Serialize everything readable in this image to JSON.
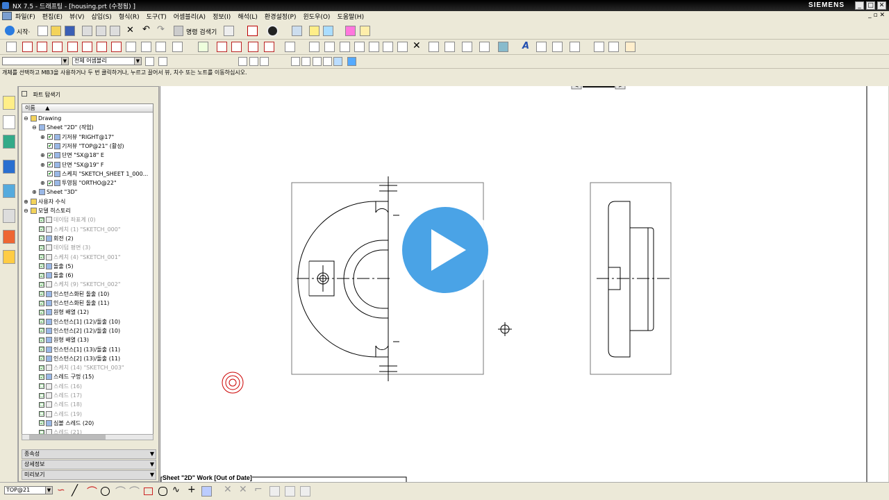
{
  "window": {
    "title": "NX 7.5 - 드래프팅 - [housing.prt (수정됨) ]",
    "brand": "SIEMENS"
  },
  "menu": [
    "파일(F)",
    "편집(E)",
    "뷰(V)",
    "삽입(S)",
    "형식(R)",
    "도구(T)",
    "어셈블리(A)",
    "정보(I)",
    "해석(L)",
    "환경설정(P)",
    "윈도우(O)",
    "도움말(H)"
  ],
  "toolbar1": {
    "start_label": "시작·",
    "command_finder_label": "명령 검색기"
  },
  "filter_bar": {
    "type_filter": "",
    "scope_filter": "전체 어셈블리"
  },
  "hint_text": "개체를 선택하고 MB3을 사용하거나 두 번 클릭하거나, 누르고 끌어서 뷰, 치수 또는 노트를 이동하십시오.",
  "navigator": {
    "title": "파트 탐색기",
    "column_header": "이름",
    "rows": [
      {
        "label": "Drawing",
        "indent": 0,
        "expander": "⊖",
        "check": "",
        "dim": false
      },
      {
        "label": "Sheet \"2D\" (작업)",
        "indent": 1,
        "expander": "⊖",
        "check": "",
        "dim": false
      },
      {
        "label": "기저뷰 \"RIGHT@17\"",
        "indent": 2,
        "expander": "⊕",
        "check": "✔",
        "dim": false
      },
      {
        "label": "기저뷰 \"TOP@21\" (활성)",
        "indent": 2,
        "expander": "",
        "check": "✔",
        "dim": false
      },
      {
        "label": "단면 \"SX@18\" E",
        "indent": 2,
        "expander": "⊕",
        "check": "✔",
        "dim": false
      },
      {
        "label": "단면 \"SX@19\" F",
        "indent": 2,
        "expander": "⊕",
        "check": "✔",
        "dim": false
      },
      {
        "label": "스케치 \"SKETCH_SHEET 1_000...",
        "indent": 2,
        "expander": "",
        "check": "✔",
        "dim": false
      },
      {
        "label": "투영됨 \"ORTHO@22\"",
        "indent": 2,
        "expander": "⊕",
        "check": "✔",
        "dim": false
      },
      {
        "label": "Sheet \"3D\"",
        "indent": 1,
        "expander": "⊕",
        "check": "",
        "dim": false
      },
      {
        "label": "사용자 수식",
        "indent": 0,
        "expander": "⊕",
        "check": "",
        "dim": false
      },
      {
        "label": "모델 히스토리",
        "indent": 0,
        "expander": "⊖",
        "check": "",
        "dim": false
      },
      {
        "label": "데이텀 좌표계 (0)",
        "indent": 1,
        "expander": "",
        "check": "☑",
        "dim": true
      },
      {
        "label": "스케치 (1) \"SKETCH_000\"",
        "indent": 1,
        "expander": "",
        "check": "☑",
        "dim": true
      },
      {
        "label": "회전 (2)",
        "indent": 1,
        "expander": "",
        "check": "☑",
        "dim": false
      },
      {
        "label": "데이텀 평면 (3)",
        "indent": 1,
        "expander": "",
        "check": "☑",
        "dim": true
      },
      {
        "label": "스케치 (4) \"SKETCH_001\"",
        "indent": 1,
        "expander": "",
        "check": "☑",
        "dim": true
      },
      {
        "label": "돌출 (5)",
        "indent": 1,
        "expander": "",
        "check": "☑",
        "dim": false
      },
      {
        "label": "돌출 (6)",
        "indent": 1,
        "expander": "",
        "check": "☑",
        "dim": false
      },
      {
        "label": "스케치 (9) \"SKETCH_002\"",
        "indent": 1,
        "expander": "",
        "check": "☑",
        "dim": true
      },
      {
        "label": "인스턴스화된 돌출 (10)",
        "indent": 1,
        "expander": "",
        "check": "☑",
        "dim": false
      },
      {
        "label": "인스턴스화된 돌출 (11)",
        "indent": 1,
        "expander": "",
        "check": "☑",
        "dim": false
      },
      {
        "label": "원형 배열 (12)",
        "indent": 1,
        "expander": "",
        "check": "☑",
        "dim": false
      },
      {
        "label": "인스턴스[1] (12)/돌출 (10)",
        "indent": 1,
        "expander": "",
        "check": "☑",
        "dim": false
      },
      {
        "label": "인스턴스[2] (12)/돌출 (10)",
        "indent": 1,
        "expander": "",
        "check": "☑",
        "dim": false
      },
      {
        "label": "원형 배열 (13)",
        "indent": 1,
        "expander": "",
        "check": "☑",
        "dim": false
      },
      {
        "label": "인스턴스[1] (13)/돌출 (11)",
        "indent": 1,
        "expander": "",
        "check": "☑",
        "dim": false
      },
      {
        "label": "인스턴스[2] (13)/돌출 (11)",
        "indent": 1,
        "expander": "",
        "check": "☑",
        "dim": false
      },
      {
        "label": "스케치 (14) \"SKETCH_003\"",
        "indent": 1,
        "expander": "",
        "check": "☑",
        "dim": true
      },
      {
        "label": "스레드 구멍 (15)",
        "indent": 1,
        "expander": "",
        "check": "☑",
        "dim": false
      },
      {
        "label": "스레드 (16)",
        "indent": 1,
        "expander": "",
        "check": "☐",
        "dim": true
      },
      {
        "label": "스레드 (17)",
        "indent": 1,
        "expander": "",
        "check": "☐",
        "dim": true
      },
      {
        "label": "스레드 (18)",
        "indent": 1,
        "expander": "",
        "check": "☐",
        "dim": true
      },
      {
        "label": "스레드 (19)",
        "indent": 1,
        "expander": "",
        "check": "☐",
        "dim": true
      },
      {
        "label": "심볼 스레드 (20)",
        "indent": 1,
        "expander": "",
        "check": "☑",
        "dim": false
      },
      {
        "label": "스레드 (21)",
        "indent": 1,
        "expander": "",
        "check": "☐",
        "dim": true
      }
    ],
    "panels": [
      "종속성",
      "상세정보",
      "미리보기"
    ]
  },
  "canvas": {
    "sheet_status": "Sheet \"2D\" Work [Out of Date]"
  },
  "bottom": {
    "view_combo": "TOP@21"
  },
  "colors": {
    "play_button": "#4aa3e6",
    "check_green": "#1a9a1a",
    "target_red": "#cc0000"
  }
}
